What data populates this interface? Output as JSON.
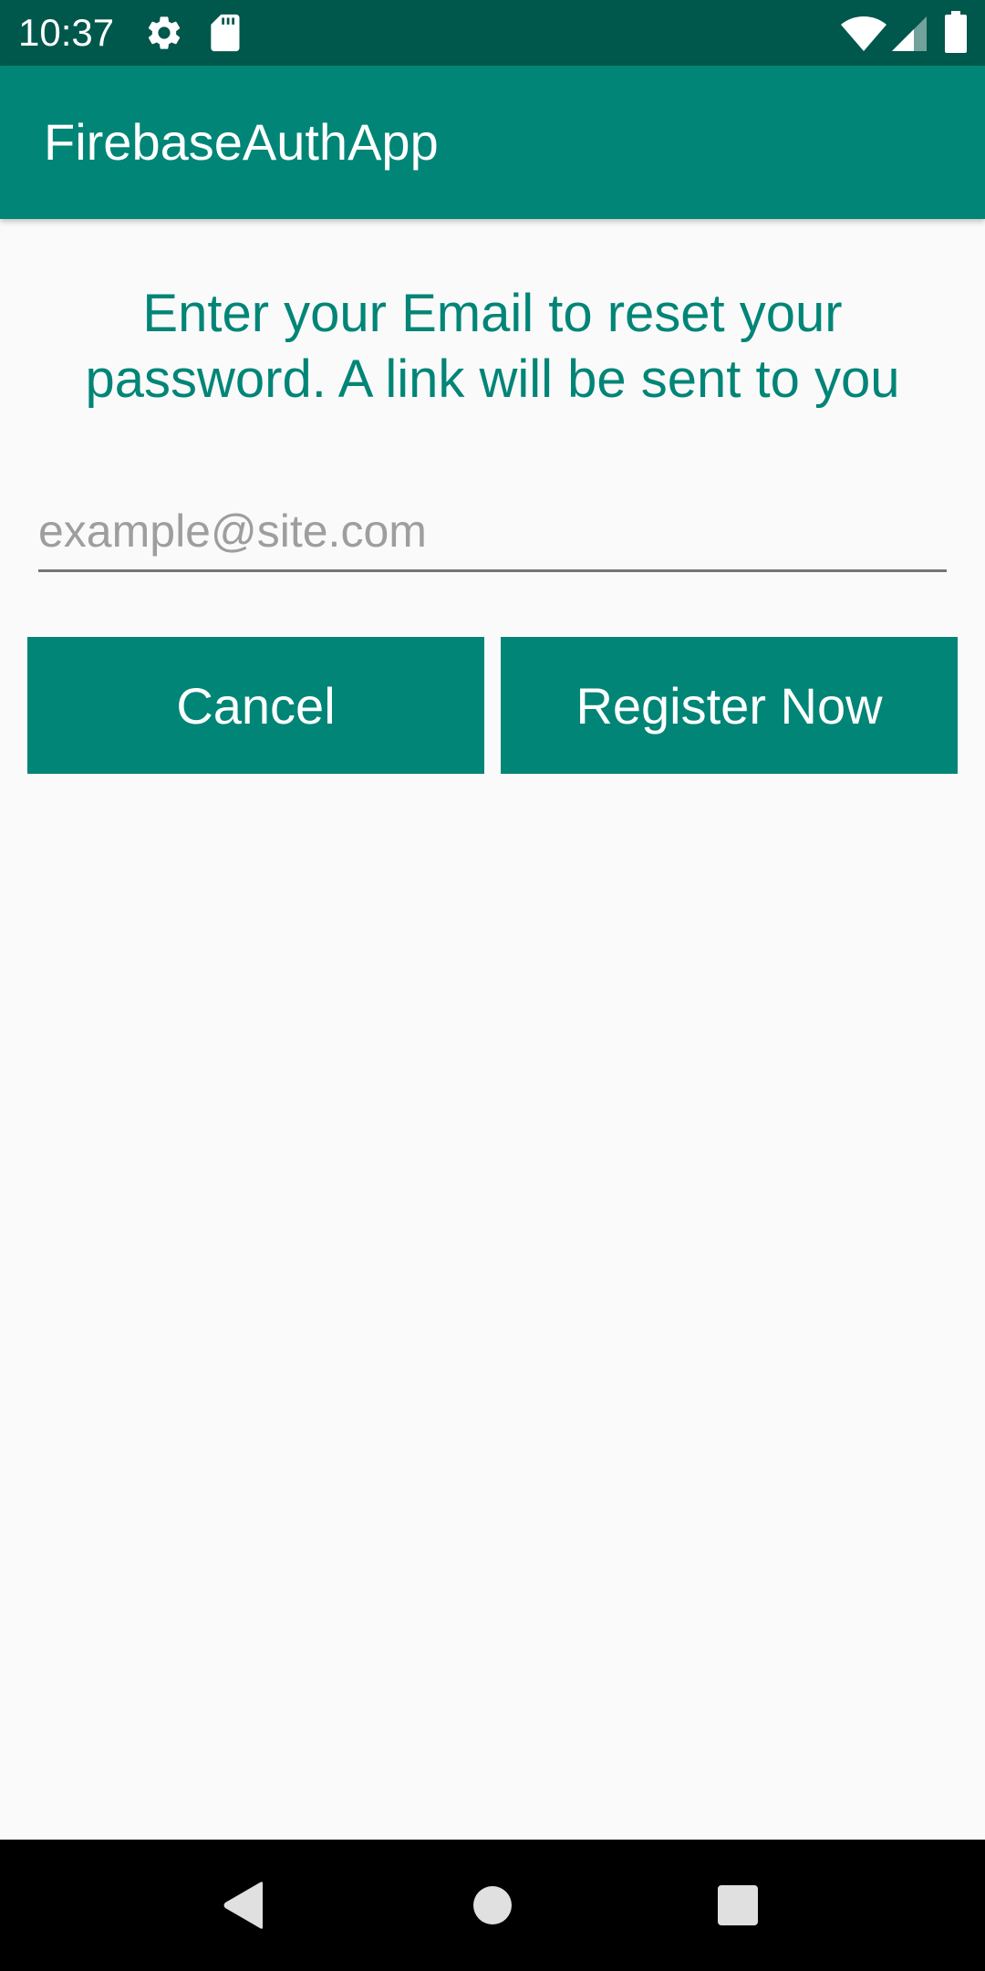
{
  "status_bar": {
    "time": "10:37",
    "icons_left": [
      "gear-icon",
      "sd-card-icon"
    ],
    "icons_right": [
      "wifi-icon",
      "cellular-signal-icon",
      "battery-icon"
    ]
  },
  "app_bar": {
    "title": "FirebaseAuthApp"
  },
  "content": {
    "instruction": "Enter your Email to reset your password. A link will be sent to you",
    "email_input": {
      "value": "",
      "placeholder": "example@site.com"
    },
    "buttons": {
      "cancel_label": "Cancel",
      "register_label": "Register Now"
    }
  },
  "nav_bar": {
    "icons": [
      "back-icon",
      "home-icon",
      "recents-icon"
    ]
  },
  "colors": {
    "primary": "#008577",
    "primary_dark": "#00574b",
    "background": "#fafafa",
    "text_on_primary": "#ffffff"
  }
}
